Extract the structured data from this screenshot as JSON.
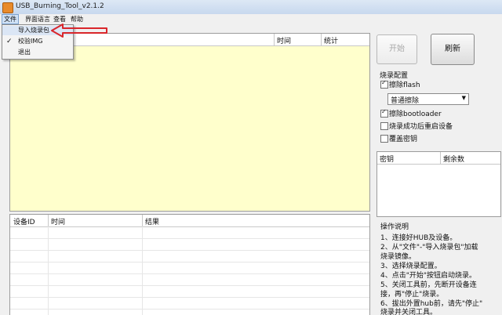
{
  "window": {
    "title": "USB_Burning_Tool_v2.1.2"
  },
  "menubar": {
    "items": [
      "文件",
      "界面语言",
      "查看",
      "帮助"
    ]
  },
  "file_menu": {
    "items": [
      "导入烧录包",
      "校验IMG",
      "退出"
    ]
  },
  "log_table": {
    "columns": [
      "",
      "时间",
      "统计"
    ]
  },
  "device_table": {
    "columns": [
      "设备ID",
      "时间",
      "结果"
    ]
  },
  "buttons": {
    "start": "开始",
    "refresh": "刷新"
  },
  "burn_config": {
    "title": "烧录配置",
    "erase_flash": "擦除flash",
    "erase_mode": "普通擦除",
    "erase_bootloader": "擦除bootloader",
    "reset_after": "烧录成功后重启设备",
    "overwrite_key": "覆盖密钥"
  },
  "key_table": {
    "columns": [
      "密钥",
      "剩余数"
    ]
  },
  "help": {
    "title": "操作说明",
    "lines": [
      "1、连接好HUB及设备。",
      "2、从\"文件\"-\"导入烧录包\"加载",
      "烧录镜像。",
      "3、选择烧录配置。",
      "4、点击\"开始\"按钮启动烧录。",
      "5、关闭工具前，先断开设备连",
      "接，再\"停止\"烧录。",
      "6、拔出外置hub前，请先\"停止\"",
      "烧录并关闭工具。"
    ]
  }
}
